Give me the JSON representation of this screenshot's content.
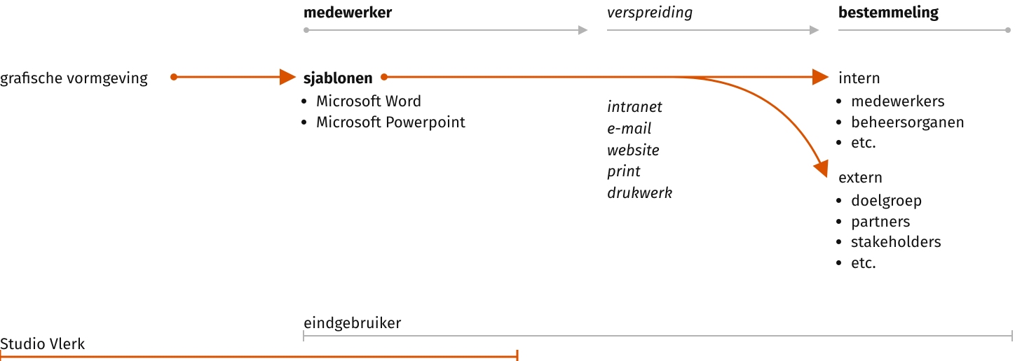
{
  "columns": {
    "col1": {
      "heading": "grafische vormgeving",
      "footer": "Studio Vlerk"
    },
    "col2": {
      "heading_top": "medewerker",
      "heading": "sjablonen",
      "bullets": [
        "Microsoft Word",
        "Microsoft Powerpoint"
      ],
      "footer": "eindgebruiker"
    },
    "col3": {
      "heading_top": "verspreiding",
      "channels": [
        "intranet",
        "e-mail",
        "website",
        "print",
        "drukwerk"
      ]
    },
    "col4": {
      "heading_top": "bestemmeling",
      "intern_label": "intern",
      "intern_bullets": [
        "medewerkers",
        "beheersorganen",
        "etc."
      ],
      "extern_label": "extern",
      "extern_bullets": [
        "doelgroep",
        "partners",
        "stakeholders",
        "etc."
      ]
    }
  },
  "colors": {
    "accent": "#d95200",
    "gray": "#b3b3b3",
    "text": "#111111"
  },
  "chart_data": {
    "type": "diagram",
    "title": "",
    "nodes": [
      {
        "id": "grafische-vormgeving",
        "label": "grafische vormgeving",
        "column": 1
      },
      {
        "id": "sjablonen",
        "label": "sjablonen",
        "column": 2,
        "children": [
          "Microsoft Word",
          "Microsoft Powerpoint"
        ]
      },
      {
        "id": "verspreiding",
        "label": "verspreiding",
        "column": 3,
        "channels": [
          "intranet",
          "e-mail",
          "website",
          "print",
          "drukwerk"
        ]
      },
      {
        "id": "intern",
        "label": "intern",
        "column": 4,
        "items": [
          "medewerkers",
          "beheersorganen",
          "etc."
        ]
      },
      {
        "id": "extern",
        "label": "extern",
        "column": 4,
        "items": [
          "doelgroep",
          "partners",
          "stakeholders",
          "etc."
        ]
      }
    ],
    "edges": [
      {
        "from": "grafische-vormgeving",
        "to": "sjablonen",
        "style": "orange-arrow"
      },
      {
        "from": "sjablonen",
        "to": "intern",
        "style": "orange-arrow"
      },
      {
        "from": "sjablonen",
        "to": "extern",
        "style": "orange-arrow-curved"
      }
    ],
    "column_headers": [
      "",
      "medewerker",
      "verspreiding",
      "bestemmeling"
    ],
    "spans": [
      {
        "label": "Studio Vlerk",
        "from_column": 1,
        "to_column": 2,
        "style": "orange-bracket"
      },
      {
        "label": "eindgebruiker",
        "from_column": 2,
        "to_column": 4,
        "style": "gray-bracket"
      }
    ]
  }
}
